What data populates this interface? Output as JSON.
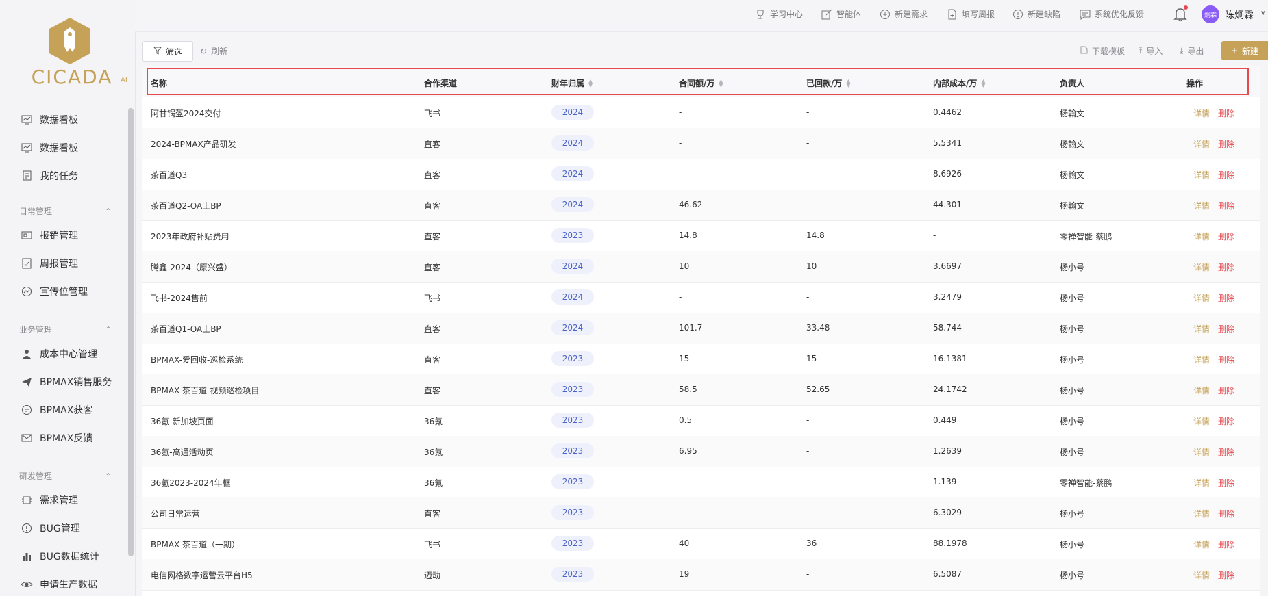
{
  "brand": {
    "name": "CICADA",
    "ai": "AI",
    "accent": "#c5a258"
  },
  "sidebar": {
    "top_items": [
      {
        "label": "数据看板",
        "icon": "dashboard-icon"
      },
      {
        "label": "数据看板",
        "icon": "dashboard-icon"
      },
      {
        "label": "我的任务",
        "icon": "task-icon"
      }
    ],
    "groups": [
      {
        "title": "日常管理",
        "items": [
          {
            "label": "报销管理",
            "icon": "receipt-icon"
          },
          {
            "label": "周报管理",
            "icon": "report-icon"
          },
          {
            "label": "宣传位管理",
            "icon": "promotion-icon"
          }
        ]
      },
      {
        "title": "业务管理",
        "items": [
          {
            "label": "成本中心管理",
            "icon": "user-icon"
          },
          {
            "label": "BPMAX销售服务",
            "icon": "send-icon"
          },
          {
            "label": "BPMAX获客",
            "icon": "chat-icon"
          },
          {
            "label": "BPMAX反馈",
            "icon": "mail-icon"
          }
        ]
      },
      {
        "title": "研发管理",
        "items": [
          {
            "label": "需求管理",
            "icon": "chip-icon"
          },
          {
            "label": "BUG管理",
            "icon": "warning-icon"
          },
          {
            "label": "BUG数据统计",
            "icon": "bar-chart-icon"
          },
          {
            "label": "申请生产数据",
            "icon": "eye-icon"
          }
        ]
      }
    ]
  },
  "header": {
    "links": [
      {
        "label": "学习中心",
        "icon": "trophy-icon"
      },
      {
        "label": "智能体",
        "icon": "edit-icon"
      },
      {
        "label": "新建需求",
        "icon": "plus-circle-icon"
      },
      {
        "label": "填写周报",
        "icon": "file-plus-icon"
      },
      {
        "label": "新建缺陷",
        "icon": "alert-circle-icon"
      },
      {
        "label": "系统优化反馈",
        "icon": "message-icon"
      }
    ],
    "avatar_text": "炯霖",
    "username": "陈炯霖"
  },
  "toolbar": {
    "filter": "筛选",
    "refresh": "刷新",
    "download_template": "下载模板",
    "import": "导入",
    "export": "导出",
    "new": "新建"
  },
  "table": {
    "columns": [
      "名称",
      "合作渠道",
      "财年归属",
      "合同额/万",
      "已回款/万",
      "内部成本/万",
      "负责人",
      "操作"
    ],
    "actions": {
      "detail": "详情",
      "delete": "删除"
    },
    "rows": [
      {
        "name": "阿甘锅盔2024交付",
        "channel": "飞书",
        "year": "2024",
        "contract": "-",
        "received": "-",
        "cost": "0.4462",
        "owner": "杨翰文"
      },
      {
        "name": "2024-BPMAX产品研发",
        "channel": "直客",
        "year": "2024",
        "contract": "-",
        "received": "-",
        "cost": "5.5341",
        "owner": "杨翰文"
      },
      {
        "name": "茶百道Q3",
        "channel": "直客",
        "year": "2024",
        "contract": "-",
        "received": "-",
        "cost": "8.6926",
        "owner": "杨翰文"
      },
      {
        "name": "茶百道Q2-OA上BP",
        "channel": "直客",
        "year": "2024",
        "contract": "46.62",
        "received": "-",
        "cost": "44.301",
        "owner": "杨翰文"
      },
      {
        "name": "2023年政府补贴费用",
        "channel": "直客",
        "year": "2023",
        "contract": "14.8",
        "received": "14.8",
        "cost": "-",
        "owner": "零禅智能-蔡鹏"
      },
      {
        "name": "腾鑫-2024（原兴盛）",
        "channel": "直客",
        "year": "2024",
        "contract": "10",
        "received": "10",
        "cost": "3.6697",
        "owner": "杨小号"
      },
      {
        "name": "飞书-2024售前",
        "channel": "飞书",
        "year": "2024",
        "contract": "-",
        "received": "-",
        "cost": "3.2479",
        "owner": "杨小号"
      },
      {
        "name": "茶百道Q1-OA上BP",
        "channel": "直客",
        "year": "2024",
        "contract": "101.7",
        "received": "33.48",
        "cost": "58.744",
        "owner": "杨小号"
      },
      {
        "name": "BPMAX-爱回收-巡检系统",
        "channel": "直客",
        "year": "2023",
        "contract": "15",
        "received": "15",
        "cost": "16.1381",
        "owner": "杨小号"
      },
      {
        "name": "BPMAX-茶百道-视频巡检项目",
        "channel": "直客",
        "year": "2023",
        "contract": "58.5",
        "received": "52.65",
        "cost": "24.1742",
        "owner": "杨小号"
      },
      {
        "name": "36氪-新加坡页面",
        "channel": "36氪",
        "year": "2023",
        "contract": "0.5",
        "received": "-",
        "cost": "0.449",
        "owner": "杨小号"
      },
      {
        "name": "36氪-高通活动页",
        "channel": "36氪",
        "year": "2023",
        "contract": "6.95",
        "received": "-",
        "cost": "1.2639",
        "owner": "杨小号"
      },
      {
        "name": "36氪2023-2024年框",
        "channel": "36氪",
        "year": "2023",
        "contract": "-",
        "received": "-",
        "cost": "1.139",
        "owner": "零禅智能-蔡鹏"
      },
      {
        "name": "公司日常运营",
        "channel": "直客",
        "year": "2023",
        "contract": "-",
        "received": "-",
        "cost": "6.3029",
        "owner": "杨小号"
      },
      {
        "name": "BPMAX-茶百道（一期）",
        "channel": "飞书",
        "year": "2023",
        "contract": "40",
        "received": "36",
        "cost": "88.1978",
        "owner": "杨小号"
      },
      {
        "name": "电信网格数字运营云平台H5",
        "channel": "迈动",
        "year": "2023",
        "contract": "19",
        "received": "-",
        "cost": "6.5087",
        "owner": "杨小号"
      }
    ]
  }
}
